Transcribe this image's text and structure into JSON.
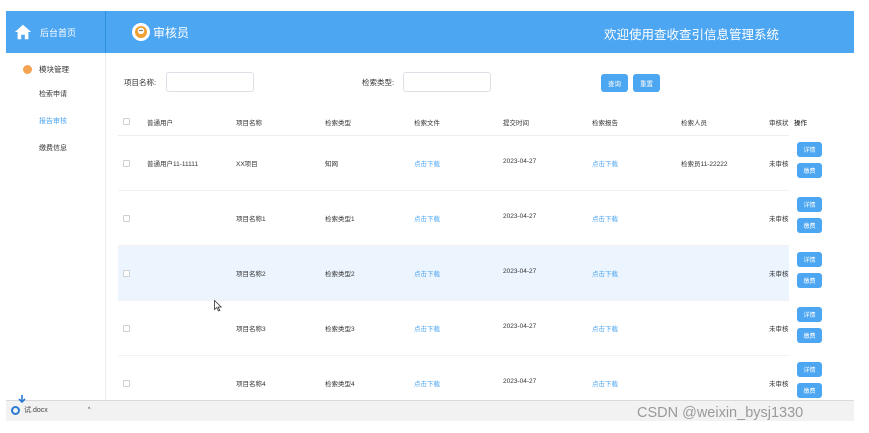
{
  "header": {
    "brand_label": "后台首页",
    "role_label": "审核员",
    "welcome": "欢迎使用查收查引信息管理系统"
  },
  "sidebar": {
    "group_label": "模块管理",
    "items": [
      {
        "label": "检索申请",
        "active": false
      },
      {
        "label": "报告审核",
        "active": true
      },
      {
        "label": "缴费信息",
        "active": false
      }
    ]
  },
  "search": {
    "project_label": "项目名称:",
    "project_value": "",
    "type_label": "检索类型:",
    "type_value": "",
    "query_button": "查询",
    "reset_button": "重置"
  },
  "table": {
    "columns": [
      "普通用户",
      "项目名称",
      "检索类型",
      "检索文件",
      "提交时间",
      "检索报告",
      "检索人员",
      "审核状",
      "操作"
    ],
    "rows": [
      {
        "user": "普通用户11-11111",
        "project": "XX项目",
        "type": "知网",
        "file": "点击下载",
        "time": "2023-04-27",
        "report": "点击下载",
        "staff": "检索员11-22222",
        "status": "未审核"
      },
      {
        "user": "",
        "project": "项目名称1",
        "type": "检索类型1",
        "file": "点击下载",
        "time": "2023-04-27",
        "report": "点击下载",
        "staff": "",
        "status": "未审核"
      },
      {
        "user": "",
        "project": "项目名称2",
        "type": "检索类型2",
        "file": "点击下载",
        "time": "2023-04-27",
        "report": "点击下载",
        "staff": "",
        "status": "未审核"
      },
      {
        "user": "",
        "project": "项目名称3",
        "type": "检索类型3",
        "file": "点击下载",
        "time": "2023-04-27",
        "report": "点击下载",
        "staff": "",
        "status": "未审核"
      },
      {
        "user": "",
        "project": "项目名称4",
        "type": "检索类型4",
        "file": "点击下载",
        "time": "2023-04-27",
        "report": "点击下载",
        "staff": "",
        "status": "未审核"
      }
    ],
    "detail_button": "详情",
    "pay_button": "缴费"
  },
  "download_bar": {
    "file_name": "试.docx",
    "chevron": "^"
  },
  "watermark": "CSDN @weixin_bysj1330",
  "colors": {
    "accent": "#4da6f2",
    "highlight_row": "#ecf5fe",
    "dot": "#f3a352"
  }
}
